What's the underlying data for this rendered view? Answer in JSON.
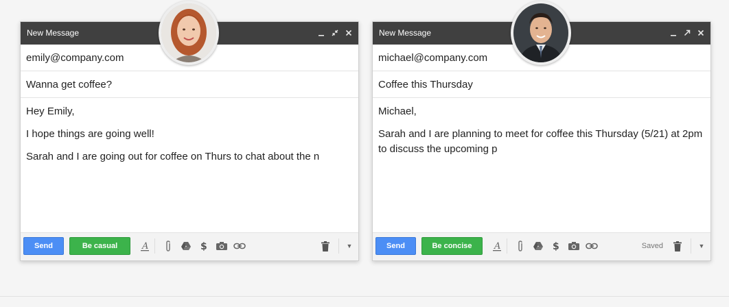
{
  "left": {
    "title": "New Message",
    "to": "emily@company.com",
    "subject": "Wanna get coffee?",
    "body": [
      "Hey Emily,",
      "I hope things are going well!",
      "Sarah and I are going out for coffee on Thurs to chat about the n"
    ],
    "send_label": "Send",
    "tone_label": "Be casual",
    "saved": ""
  },
  "right": {
    "title": "New Message",
    "to": "michael@company.com",
    "subject": "Coffee this Thursday",
    "body": [
      "Michael,",
      "Sarah and I are planning to meet for coffee this Thursday (5/21) at 2pm to discuss the upcoming p"
    ],
    "send_label": "Send",
    "tone_label": "Be concise",
    "saved": "Saved"
  },
  "colors": {
    "titlebar": "#404040",
    "send": "#4c8ef5",
    "tone": "#3cb34b"
  },
  "icons": [
    "minimize-icon",
    "exit-fullscreen-icon",
    "fullscreen-icon",
    "close-icon",
    "text-format-icon",
    "attach-icon",
    "drive-icon",
    "dollar-icon",
    "camera-icon",
    "link-icon",
    "trash-icon",
    "chevron-down-icon"
  ]
}
